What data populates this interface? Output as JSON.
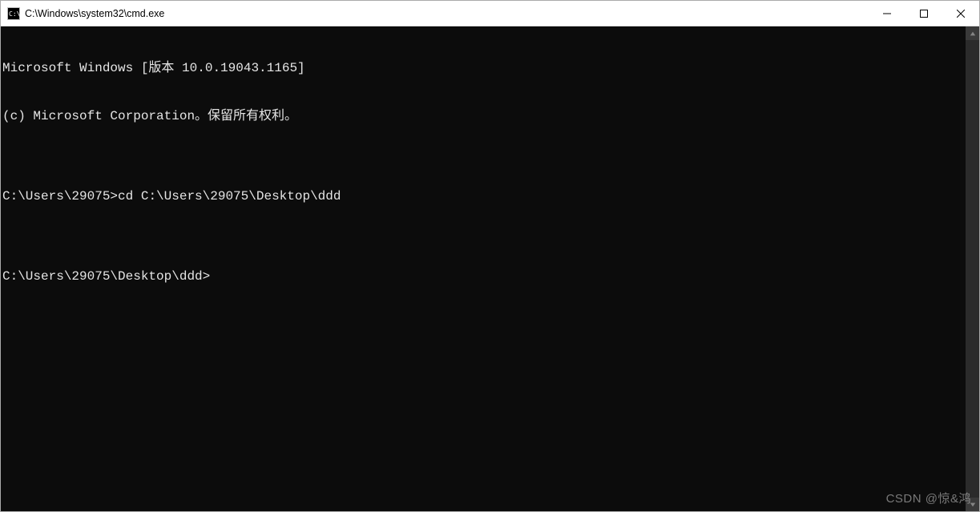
{
  "window": {
    "title": "C:\\Windows\\system32\\cmd.exe"
  },
  "terminal": {
    "banner_line1": "Microsoft Windows [版本 10.0.19043.1165]",
    "banner_line2": "(c) Microsoft Corporation。保留所有权利。",
    "blank1": "",
    "prompt1": "C:\\Users\\29075>",
    "command1": "cd C:\\Users\\29075\\Desktop\\ddd",
    "blank2": "",
    "prompt2": "C:\\Users\\29075\\Desktop\\ddd>",
    "command2": ""
  },
  "watermark": "CSDN @惊&鸿"
}
